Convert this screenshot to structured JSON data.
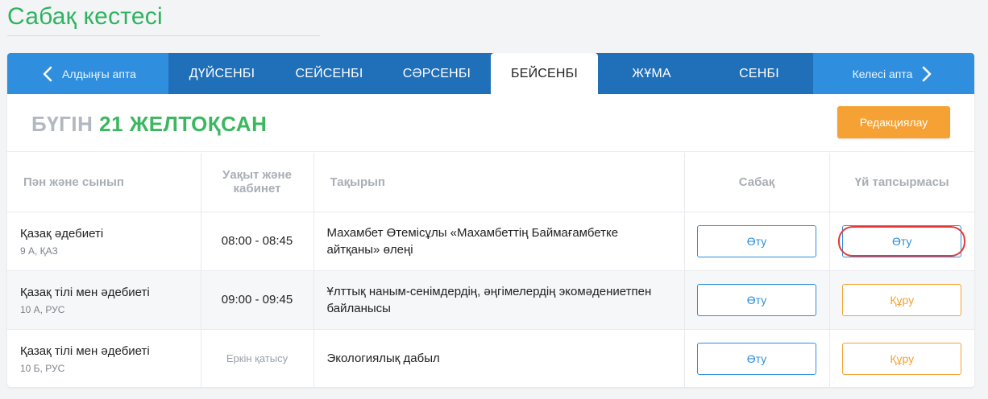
{
  "page": {
    "title": "Сабақ кестесі"
  },
  "week_nav": {
    "prev_label": "Алдыңғы апта",
    "next_label": "Келесі апта",
    "days": [
      "ДҮЙСЕНБІ",
      "СЕЙСЕНБІ",
      "СӘРСЕНБІ",
      "БЕЙСЕНБІ",
      "ЖҰМА",
      "СЕНБІ"
    ],
    "active_day": "БЕЙСЕНБІ"
  },
  "today": {
    "prefix": "БҮГІН",
    "date": "21 ЖЕЛТОҚСАН",
    "edit_label": "Редакциялау"
  },
  "table": {
    "headers": {
      "subject": "Пән және сынып",
      "time": "Уақыт және кабинет",
      "topic": "Тақырып",
      "lesson": "Сабақ",
      "homework": "Үй тапсырмасы"
    },
    "rows": [
      {
        "subject": "Қазақ әдебиеті",
        "class": "9 А, ҚАЗ",
        "time": "08:00 - 08:45",
        "topic": "Махамбет Өтемісұлы «Махамбеттің Баймағамбетке айтқаны» өлеңі",
        "lesson_btn": "Өту",
        "homework_btn": "Өту"
      },
      {
        "subject": "Қазақ тілі мен әдебиеті",
        "class": "10 А, РУС",
        "time": "09:00 - 09:45",
        "topic": "Ұлттық наным-сенімдердің, әңгімелердің экомәдениетпен байланысы",
        "lesson_btn": "Өту",
        "homework_btn": "Құру"
      },
      {
        "subject": "Қазақ тілі мен әдебиеті",
        "class": "10 Б, РУС",
        "time": "Еркін қатысу",
        "topic": "Экологиялық дабыл",
        "lesson_btn": "Өту",
        "homework_btn": "Құру"
      }
    ]
  },
  "colors": {
    "title_green": "#2fb35f",
    "nav_blue": "#2f8fde",
    "days_blue": "#1f6fb9",
    "accent_orange": "#f5a133",
    "highlight_red": "#e33a3a"
  },
  "icons": {
    "prev": "chevron-left-icon",
    "next": "chevron-right-icon"
  }
}
